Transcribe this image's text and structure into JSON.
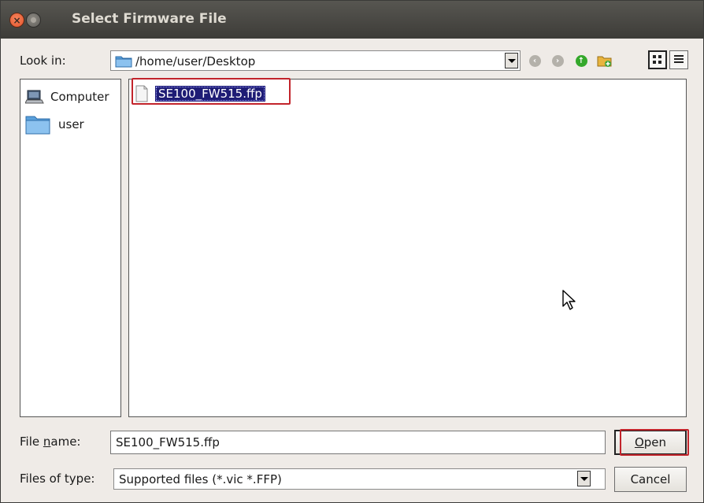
{
  "window": {
    "title": "Select Firmware File"
  },
  "look_in": {
    "label": "Look in:",
    "path": "/home/user/Desktop"
  },
  "sidebar": {
    "items": [
      {
        "label": "Computer",
        "icon": "computer-icon"
      },
      {
        "label": "user",
        "icon": "folder-icon"
      }
    ]
  },
  "files": [
    {
      "name": "SE100_FW515.ffp",
      "selected": true,
      "icon": "file-icon"
    }
  ],
  "file_name": {
    "label_prefix": "File ",
    "label_mnemonic": "n",
    "label_suffix": "ame:",
    "value": "SE100_FW515.ffp"
  },
  "file_type": {
    "label": "Files of type:",
    "value": "Supported files (*.vic *.FFP)"
  },
  "buttons": {
    "open_mnemonic": "O",
    "open_rest": "pen",
    "cancel": "Cancel"
  },
  "colors": {
    "selection": "#1e1c75",
    "highlight_box": "#c2242b",
    "titlebar": "#3d3c38"
  }
}
